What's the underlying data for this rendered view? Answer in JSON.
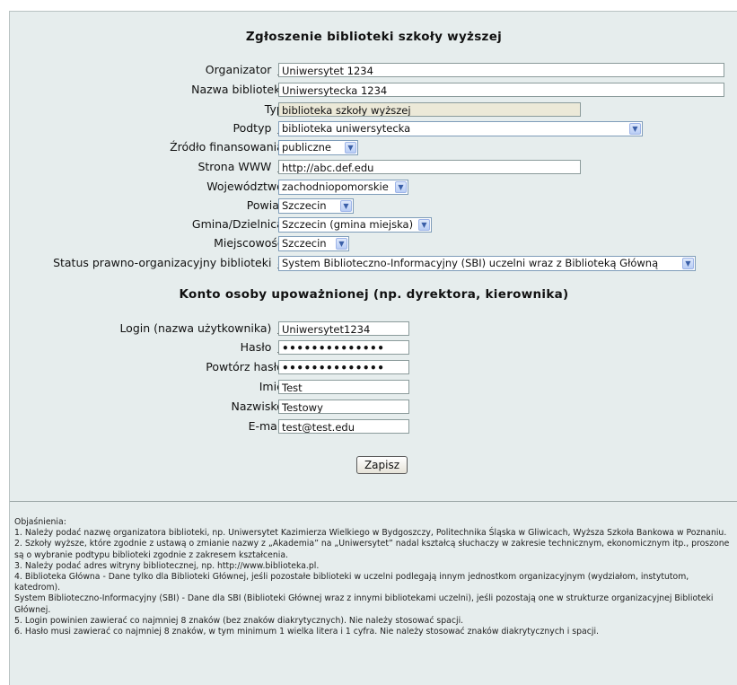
{
  "form": {
    "title": "Zgłoszenie biblioteki szkoły wyższej",
    "fields": [
      {
        "label": "Organizator",
        "fn": "1",
        "value": "Uniwersytet 1234",
        "kind": "text"
      },
      {
        "label": "Nazwa biblioteki",
        "fn": "",
        "value": "Uniwersytecka 1234",
        "kind": "text"
      },
      {
        "label": "Typ",
        "fn": "",
        "value": "biblioteka szkoły wyższej",
        "kind": "readonly"
      },
      {
        "label": "Podtyp",
        "fn": "2",
        "value": "biblioteka uniwersytecka",
        "kind": "select"
      },
      {
        "label": "Źródło finansowania",
        "fn": "",
        "value": "publiczne",
        "kind": "select"
      },
      {
        "label": "Strona WWW",
        "fn": "3",
        "value": "http://abc.def.edu",
        "kind": "text"
      },
      {
        "label": "Województwo",
        "fn": "",
        "value": "zachodniopomorskie",
        "kind": "select"
      },
      {
        "label": "Powiat",
        "fn": "",
        "value": "Szczecin",
        "kind": "select"
      },
      {
        "label": "Gmina/Dzielnica",
        "fn": "",
        "value": "Szczecin (gmina miejska)",
        "kind": "select"
      },
      {
        "label": "Miejscowość",
        "fn": "",
        "value": "Szczecin",
        "kind": "select"
      },
      {
        "label": "Status prawno-organizacyjny biblioteki",
        "fn": "4",
        "value": "System Biblioteczno-Informacyjny (SBI) uczelni wraz z Biblioteką Główną",
        "kind": "select"
      }
    ]
  },
  "account": {
    "title": "Konto osoby upoważnionej (np. dyrektora, kierownika)",
    "fields": [
      {
        "label": "Login (nazwa użytkownika)",
        "fn": "5",
        "value": "Uniwersytet1234",
        "kind": "text"
      },
      {
        "label": "Hasło",
        "fn": "6",
        "value": "••••••••••••••",
        "kind": "password"
      },
      {
        "label": "Powtórz hasło",
        "fn": "",
        "value": "••••••••••••••",
        "kind": "password"
      },
      {
        "label": "Imię",
        "fn": "",
        "value": "Test",
        "kind": "text"
      },
      {
        "label": "Nazwisko",
        "fn": "",
        "value": "Testowy",
        "kind": "text"
      },
      {
        "label": "E-mail",
        "fn": "",
        "value": "test@test.edu",
        "kind": "text"
      }
    ],
    "submit_label": "Zapisz"
  },
  "notes": {
    "heading": "Objaśnienia:",
    "items": [
      "1. Należy podać nazwę organizatora biblioteki, np. Uniwersytet Kazimierza Wielkiego w Bydgoszczy, Politechnika Śląska w Gliwicach, Wyższa Szkoła Bankowa w Poznaniu.",
      "2. Szkoły wyższe, które zgodnie z ustawą o zmianie nazwy z „Akademia” na „Uniwersytet” nadal kształcą słuchaczy w zakresie technicznym, ekonomicznym itp., proszone są o wybranie podtypu biblioteki zgodnie z zakresem kształcenia.",
      "3. Należy podać adres witryny bibliotecznej, np. http://www.biblioteka.pl.",
      "4. Biblioteka Główna - Dane tylko dla Biblioteki Głównej, jeśli pozostałe biblioteki w uczelni podlegają innym jednostkom organizacyjnym (wydziałom, instytutom, katedrom).",
      "System Biblioteczno-Informacyjny (SBI) - Dane dla SBI (Biblioteki Głównej wraz z innymi bibliotekami uczelni), jeśli pozostają one w strukturze organizacyjnej Biblioteki Głównej.",
      "5. Login powinien zawierać co najmniej 8 znaków (bez znaków diakrytycznych). Nie należy stosować spacji.",
      "6. Hasło musi zawierać co najmniej 8 znaków, w tym minimum 1 wielka litera i 1 cyfra. Nie należy stosować znaków diakrytycznych i spacji."
    ]
  }
}
